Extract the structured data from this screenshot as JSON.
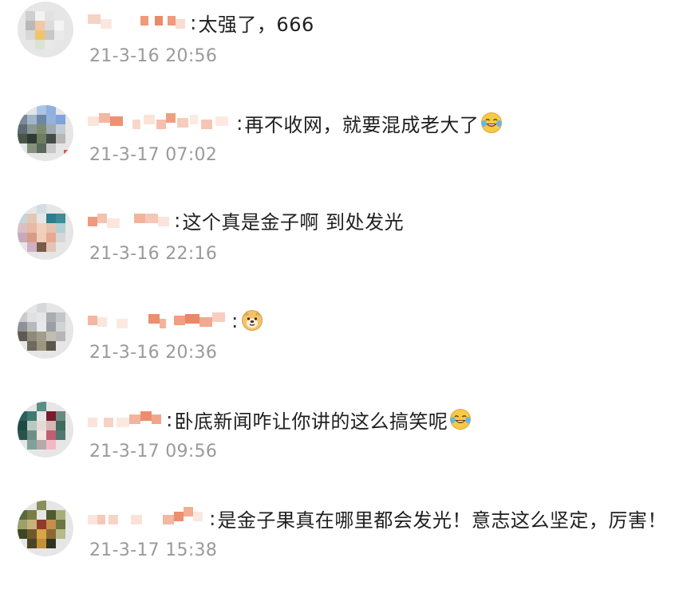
{
  "comments": [
    {
      "author": "",
      "text": "太强了，666",
      "emoji": "",
      "time": "21-3-16 20:56"
    },
    {
      "author": "",
      "text": "再不收网，就要混成老大了",
      "emoji": "laughing-tears-emoji",
      "time": "21-3-17 07:02"
    },
    {
      "author": "",
      "text": "这个真是金子啊 到处发光",
      "emoji": "",
      "time": "21-3-16 22:16"
    },
    {
      "author": "",
      "text": "",
      "emoji": "doge-emoji",
      "time": "21-3-16 20:36"
    },
    {
      "author": "",
      "text": "卧底新闻咋让你讲的这么搞笑呢",
      "emoji": "laughing-tears-emoji",
      "time": "21-3-17 09:56"
    },
    {
      "author": "",
      "text": "是金子果真在哪里都会发光！意志这么坚定，厉害！",
      "emoji": "",
      "time": "21-3-17 15:38"
    }
  ],
  "colors": {
    "text": "#1f1f1f",
    "time": "#9a9a9a",
    "name_accent": "#e8734f",
    "background": "#ffffff"
  }
}
